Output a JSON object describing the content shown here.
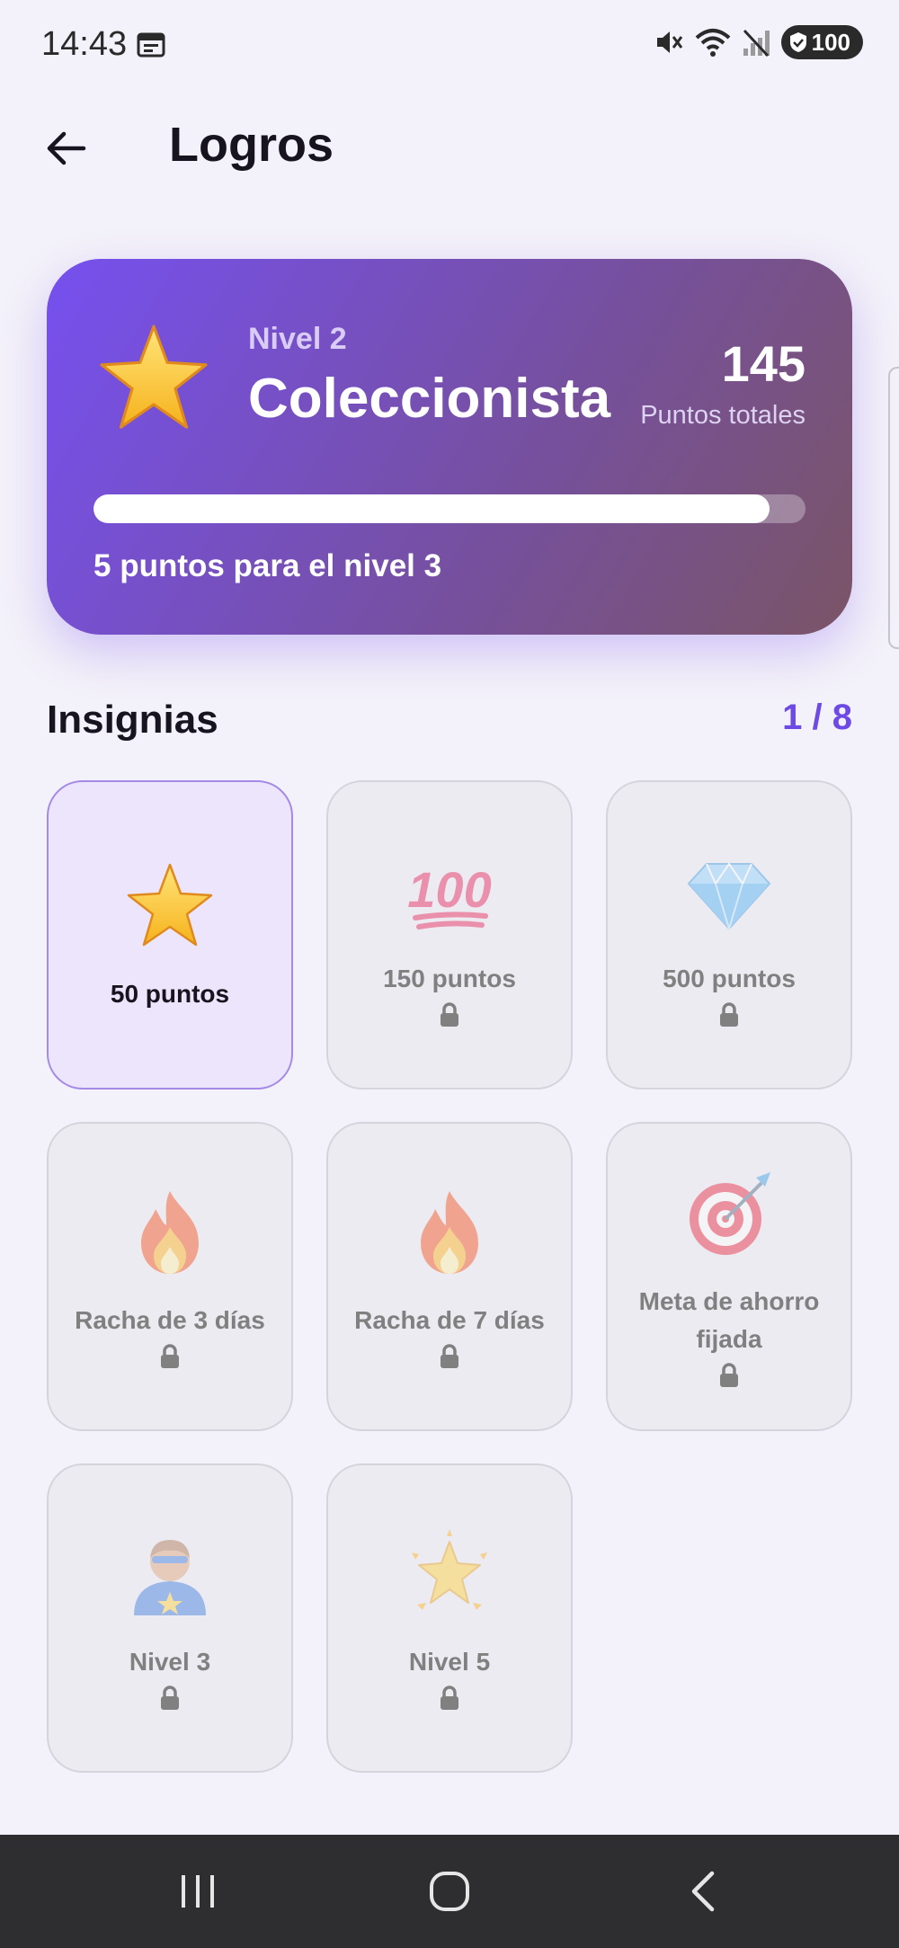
{
  "status_bar": {
    "time": "14:43",
    "battery": "100",
    "icons": [
      "calendar-icon",
      "mute-icon",
      "wifi-icon",
      "no-signal-icon",
      "battery-icon"
    ]
  },
  "app_bar": {
    "title": "Logros",
    "back_icon": "arrow-left-icon"
  },
  "level_card": {
    "level_label": "Nivel 2",
    "level_name": "Coleccionista",
    "points_value": "145",
    "points_label": "Puntos totales",
    "progress_fraction": 0.95,
    "progress_text": "5 puntos para el nivel 3",
    "icon": "star-icon",
    "gradient_colors": [
      "#7650ef",
      "#76509c",
      "#7a5566"
    ]
  },
  "badges_section": {
    "title": "Insignias",
    "count": "1 / 8",
    "accent_color": "#6d49e6"
  },
  "badges": [
    {
      "label": "50 puntos",
      "icon": "star-icon",
      "unlocked": true
    },
    {
      "label": "150 puntos",
      "icon": "hundred-points-icon",
      "unlocked": false
    },
    {
      "label": "500 puntos",
      "icon": "diamond-icon",
      "unlocked": false
    },
    {
      "label": "Racha de 3 días",
      "icon": "fire-icon",
      "unlocked": false
    },
    {
      "label": "Racha de 7 días",
      "icon": "fire-icon",
      "unlocked": false
    },
    {
      "label": "Meta de ahorro fijada",
      "icon": "target-icon",
      "unlocked": false
    },
    {
      "label": "Nivel 3",
      "icon": "superhero-icon",
      "unlocked": false
    },
    {
      "label": "Nivel 5",
      "icon": "glowing-star-icon",
      "unlocked": false
    }
  ],
  "nav_bar": {
    "buttons": [
      "recents-icon",
      "home-icon",
      "back-icon"
    ]
  }
}
